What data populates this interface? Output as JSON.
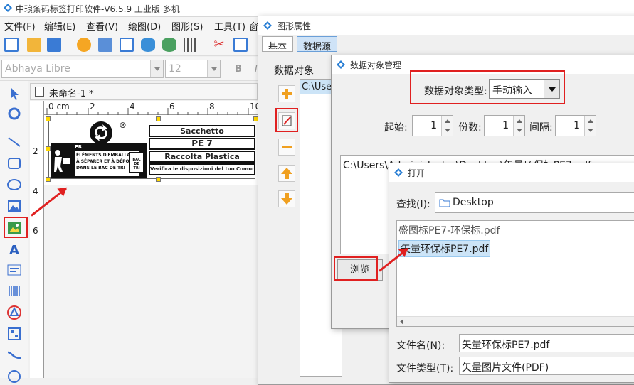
{
  "app": {
    "title": "中琅条码标签打印软件-V6.5.9 工业版 多机"
  },
  "menu": [
    "文件(F)",
    "编辑(E)",
    "查看(V)",
    "绘图(D)",
    "图形(S)",
    "工具(T)",
    "窗"
  ],
  "fontbar": {
    "font_name": "Abhaya Libre",
    "font_size": "12",
    "bold": "B",
    "italic": "I"
  },
  "document": {
    "tab_label": "未命名-1 *"
  },
  "ruler": {
    "h_ticks": [
      "0 cm",
      "2",
      "4",
      "6",
      "8",
      "10"
    ],
    "v_ticks": [
      "2",
      "4",
      "6"
    ]
  },
  "label": {
    "fr": "FR",
    "text_block": [
      "ÉLÉMENTS D'EMBALLAGE",
      "À SÉPARER ET À DÉPOSER",
      "DANS LE BAC DE TRI"
    ],
    "bin_text": [
      "BAC",
      "DE",
      "TRI"
    ],
    "registered": "®",
    "rows": [
      "Sacchetto",
      "PE 7",
      "Raccolta Plastica",
      "Verifica le disposizioni del tuo Comune"
    ]
  },
  "props_dialog": {
    "title": "图形属性",
    "tabs": [
      "基本",
      "数据源"
    ],
    "group_label": "数据对象",
    "list_item": "C:\\Use"
  },
  "dom_dialog": {
    "title": "数据对象管理",
    "type_label": "数据对象类型:",
    "type_value": "手动输入",
    "start_label": "起始:",
    "start_value": "1",
    "copies_label": "份数:",
    "copies_value": "1",
    "interval_label": "间隔:",
    "interval_value": "1",
    "content": "C:\\Users\\Administrator\\Desktop\\矢量环保标PE7.pdf",
    "browse_label": "浏览"
  },
  "open_dialog": {
    "title": "打开",
    "lookin_label": "查找(I):",
    "lookin_value": "Desktop",
    "files": [
      "盛图标PE7-环保标.pdf",
      "矢量环保标PE7.pdf"
    ],
    "filename_label": "文件名(N):",
    "filename_value": "矢量环保标PE7.pdf",
    "filetype_label": "文件类型(T):",
    "filetype_value": "矢量图片文件(PDF)"
  },
  "colors": {
    "highlight_red": "#e02020",
    "selection_blue": "#cce4f7",
    "handle_yellow": "#ffd800"
  }
}
